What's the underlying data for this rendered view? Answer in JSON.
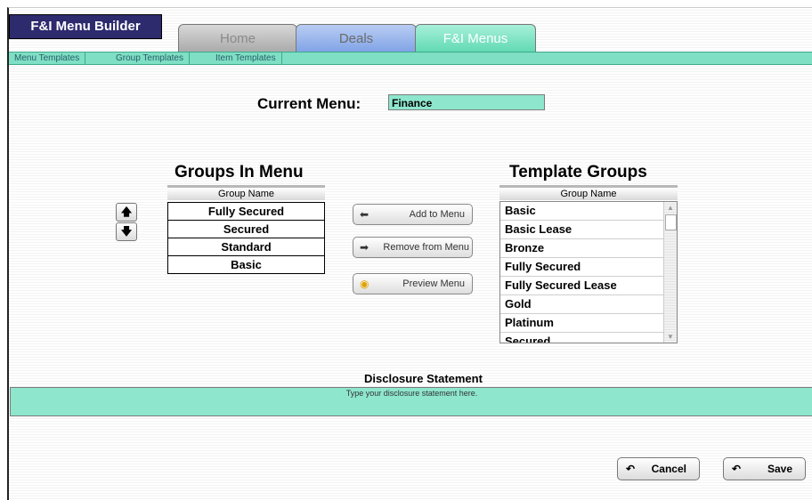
{
  "app": {
    "title": "F&I Menu Builder"
  },
  "tabs": [
    {
      "label": "Home"
    },
    {
      "label": "Deals"
    },
    {
      "label": "F&I Menus"
    }
  ],
  "subnav": [
    "Menu Templates",
    "Group Templates",
    "Item Templates"
  ],
  "current_menu": {
    "label": "Current Menu:",
    "value": "Finance"
  },
  "groups_in_menu": {
    "title": "Groups In Menu",
    "column": "Group Name",
    "rows": [
      "Fully Secured",
      "Secured",
      "Standard",
      "Basic"
    ]
  },
  "order_buttons": {
    "up_icon": "arrow-up-icon",
    "down_icon": "arrow-down-icon"
  },
  "actions": {
    "add": "Add to Menu",
    "remove": "Remove from Menu",
    "preview": "Preview Menu"
  },
  "template_groups": {
    "title": "Template Groups",
    "column": "Group Name",
    "rows": [
      "Basic",
      "Basic Lease",
      "Bronze",
      "Fully Secured",
      "Fully Secured Lease",
      "Gold",
      "Platinum",
      "Secured"
    ]
  },
  "disclosure": {
    "title": "Disclosure Statement",
    "placeholder": "Type your disclosure statement here."
  },
  "footer": {
    "cancel": "Cancel",
    "save": "Save"
  },
  "colors": {
    "brand": "#2d2a6e",
    "accent": "#8ee6cd",
    "tab_active": "#5fd9b2"
  }
}
